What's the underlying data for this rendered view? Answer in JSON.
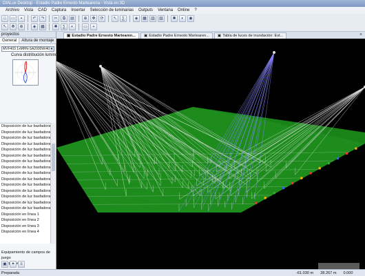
{
  "window": {
    "title": "DIALux Desktop - Estadio Padre Ernesto Martearena - Vista en 3D"
  },
  "menu": [
    "Archivo",
    "Vista",
    "CAD",
    "Captura",
    "Insertar",
    "Selección de luminarias",
    "Outputs",
    "Ventana",
    "Online",
    "?"
  ],
  "left_panel": {
    "header": "proyectos",
    "tabs": [
      "General",
      "Altura de montaje"
    ],
    "luminaire_select": "MVF403 1xMHN-SA2000W/400V",
    "curve_label": "Curva distribución luminosa",
    "items": [
      "Disposición de luz basfadora 49",
      "Disposición de luz basfadora 50",
      "Disposición de luz basfadora 51",
      "Disposición de luz basfadora 52",
      "Disposición de luz basfadora 53",
      "Disposición de luz basfadora 54",
      "Disposición de luz basfadora 55",
      "Disposición de luz basfadora 56",
      "Disposición de luz basfadora 57",
      "Disposición de luz basfadora 58",
      "Disposición de luz basfadora 59",
      "Disposición de luz basfadora 60",
      "Disposición de luz basfadora 61",
      "Disposición de luz basfadora 62",
      "Disposición de luz basfadora 63",
      "Disposición en línea 1",
      "Disposición en línea 2",
      "Disposición en línea 3",
      "Disposición en línea 4"
    ],
    "footer_lines": [
      "Equipamiento de campos de juego",
      "y deportivos"
    ]
  },
  "doc_tabs": [
    {
      "label": "Estadio Padre Ernesto Martearen...",
      "active": true
    },
    {
      "label": "Estadio Padre Ernesto Martearen...",
      "active": false
    },
    {
      "label": "Tabla de luces de inundación: Est...",
      "active": false
    }
  ],
  "status": {
    "left": "Preparada",
    "x": "-61.030 m",
    "y": "28.267 m",
    "z": "0.000"
  },
  "colors": {
    "field": "#1d8c1d",
    "field_dark": "#147014",
    "beam": "#e6e6e6",
    "beam_blue": "#8a8aff",
    "background": "#000000"
  }
}
